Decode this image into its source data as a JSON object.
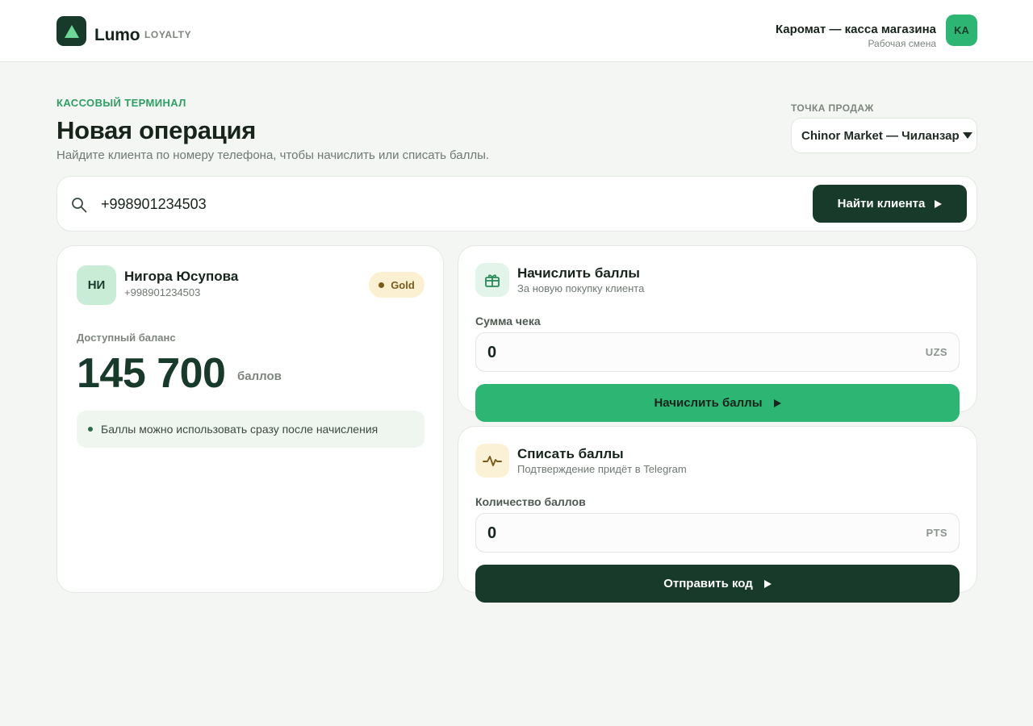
{
  "header": {
    "logo_name": "Lumo",
    "logo_tag": "LOYALTY",
    "user_name": "Каромат — касса магазина",
    "user_role": "Рабочая смена",
    "user_initials": "KA"
  },
  "page": {
    "eyebrow": "КАССОВЫЙ ТЕРМИНАЛ",
    "title": "Новая операция",
    "subtitle": "Найдите клиента по номеру телефона, чтобы начислить или списать баллы."
  },
  "store": {
    "label": "ТОЧКА ПРОДАЖ",
    "selected": "Chinor Market — Чиланзар"
  },
  "search": {
    "value": "+998901234503",
    "button_label": "Найти клиента"
  },
  "customer": {
    "initials": "НИ",
    "name": "Нигора Юсупова",
    "phone": "+998901234503",
    "tier": "Gold",
    "balance_label": "Доступный баланс",
    "balance_value": "145 700",
    "balance_unit": "баллов",
    "note": "Баллы можно использовать сразу после начисления"
  },
  "earn": {
    "title": "Начислить баллы",
    "subtitle": "За новую покупку клиента",
    "field_label": "Сумма чека",
    "field_value": "0",
    "field_unit": "UZS",
    "button_label": "Начислить баллы",
    "icon": "gift-icon"
  },
  "spend": {
    "title": "Списать баллы",
    "subtitle": "Подтверждение придёт в Telegram",
    "field_label": "Количество баллов",
    "field_value": "0",
    "field_unit": "PTS",
    "button_label": "Отправить код",
    "icon": "pulse-icon"
  },
  "colors": {
    "brand_dark": "#173a2b",
    "brand_green": "#2db673",
    "accent_text": "#2f9d64",
    "gold_bg": "#fbf1d2",
    "gold_text": "#7a5b1c"
  }
}
